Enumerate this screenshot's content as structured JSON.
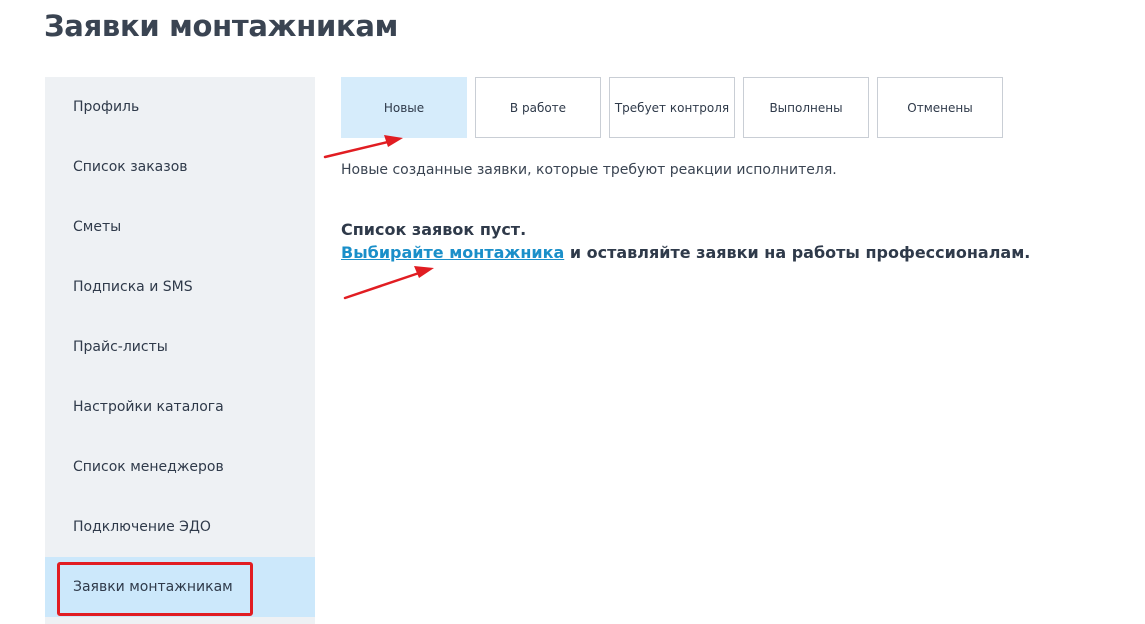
{
  "page": {
    "title": "Заявки монтажникам"
  },
  "sidebar": {
    "items": [
      {
        "label": "Профиль"
      },
      {
        "label": "Список заказов"
      },
      {
        "label": "Сметы"
      },
      {
        "label": "Подписка и SMS"
      },
      {
        "label": "Прайс-листы"
      },
      {
        "label": "Настройки каталога"
      },
      {
        "label": "Список менеджеров"
      },
      {
        "label": "Подключение ЭДО"
      },
      {
        "label": "Заявки монтажникам"
      }
    ],
    "active_index": 8
  },
  "tabs": {
    "items": [
      {
        "label": "Новые"
      },
      {
        "label": "В работе"
      },
      {
        "label": "Требует контроля"
      },
      {
        "label": "Выполнены"
      },
      {
        "label": "Отменены"
      }
    ],
    "active_index": 0
  },
  "content": {
    "description": "Новые созданные заявки, которые требуют реакции исполнителя.",
    "empty_title": "Список заявок пуст.",
    "empty_link": "Выбирайте монтажника",
    "empty_rest": " и оставляйте заявки на работы профессионалам."
  },
  "colors": {
    "accent": "#1a8fc9",
    "active_bg": "#cce8fb",
    "annotation": "#e11d22"
  }
}
